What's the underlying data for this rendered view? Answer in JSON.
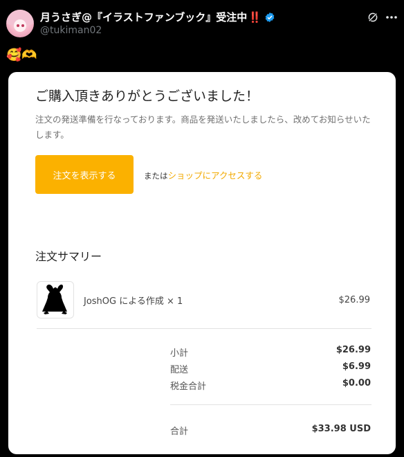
{
  "author": {
    "display_name": "月うさぎ@『イラストファンブック』受注中",
    "emoji_suffix": "‼️",
    "handle": "@tukiman02"
  },
  "tweet": {
    "text": "🥰🫶"
  },
  "card": {
    "title": "ご購入頂きありがとうございました！",
    "message": "注文の発送準備を行なっております。商品を発送いたしましたら、改めてお知らせいたします。",
    "order_button": "注文を表示する",
    "or_text": "または",
    "shop_link": "ショップにアクセスする",
    "summary_title": "注文サマリー",
    "product": {
      "name": "JoshOG による作成 × 1",
      "price": "$26.99"
    },
    "subtotal": {
      "label": "小計",
      "value": "$26.99"
    },
    "shipping": {
      "label": "配送",
      "value": "$6.99"
    },
    "tax": {
      "label": "税金合計",
      "value": "$0.00"
    },
    "total": {
      "label": "合計",
      "value": "$33.98 USD"
    }
  },
  "colors": {
    "accent": "#fbb100",
    "link": "#f2a900",
    "verified": "#1d9bf0"
  }
}
